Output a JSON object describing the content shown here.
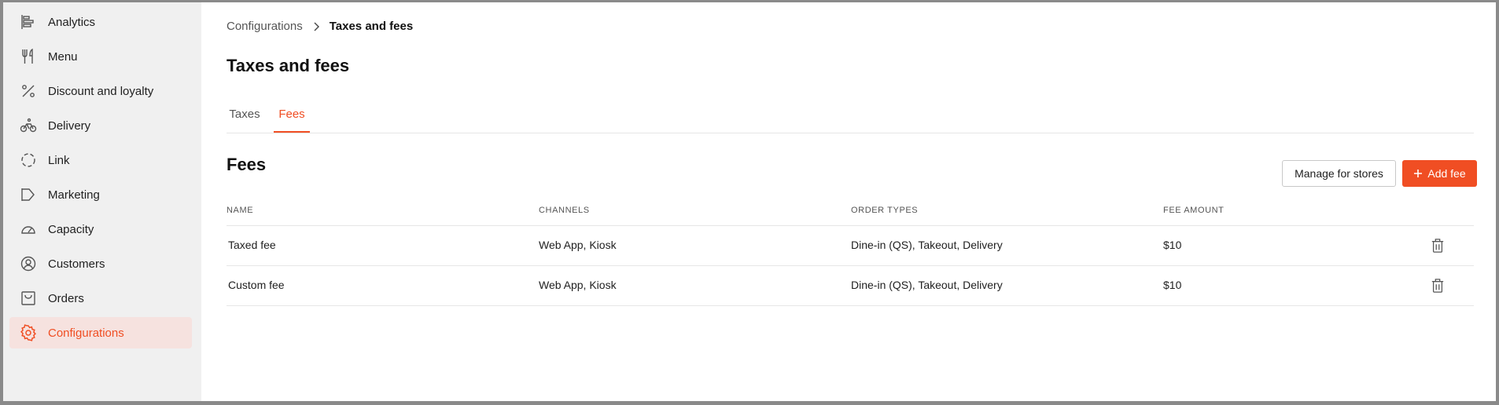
{
  "sidebar": {
    "items": [
      {
        "label": "Analytics",
        "icon": "analytics-icon"
      },
      {
        "label": "Menu",
        "icon": "utensils-icon"
      },
      {
        "label": "Discount and loyalty",
        "icon": "percent-icon"
      },
      {
        "label": "Delivery",
        "icon": "bike-icon"
      },
      {
        "label": "Link",
        "icon": "link-circle-icon"
      },
      {
        "label": "Marketing",
        "icon": "megaphone-icon"
      },
      {
        "label": "Capacity",
        "icon": "gauge-icon"
      },
      {
        "label": "Customers",
        "icon": "customers-icon"
      },
      {
        "label": "Orders",
        "icon": "tray-icon"
      },
      {
        "label": "Configurations",
        "icon": "gear-icon",
        "active": true
      }
    ]
  },
  "breadcrumb": {
    "parent": "Configurations",
    "current": "Taxes and fees"
  },
  "page": {
    "title": "Taxes and fees"
  },
  "tabs": [
    {
      "label": "Taxes"
    },
    {
      "label": "Fees",
      "active": true
    }
  ],
  "section": {
    "title": "Fees",
    "manage_label": "Manage for stores",
    "add_label": "Add fee"
  },
  "table": {
    "headers": [
      "NAME",
      "CHANNELS",
      "ORDER TYPES",
      "FEE AMOUNT"
    ],
    "rows": [
      {
        "name": "Taxed fee",
        "channels": "Web App, Kiosk",
        "order_types": "Dine-in (QS), Takeout, Delivery",
        "amount": "$10"
      },
      {
        "name": "Custom fee",
        "channels": "Web App, Kiosk",
        "order_types": "Dine-in (QS), Takeout, Delivery",
        "amount": "$10"
      }
    ]
  },
  "colors": {
    "accent": "#f04e23",
    "sidebar_bg": "#f0f0f0",
    "active_bg": "#f6e2df"
  }
}
